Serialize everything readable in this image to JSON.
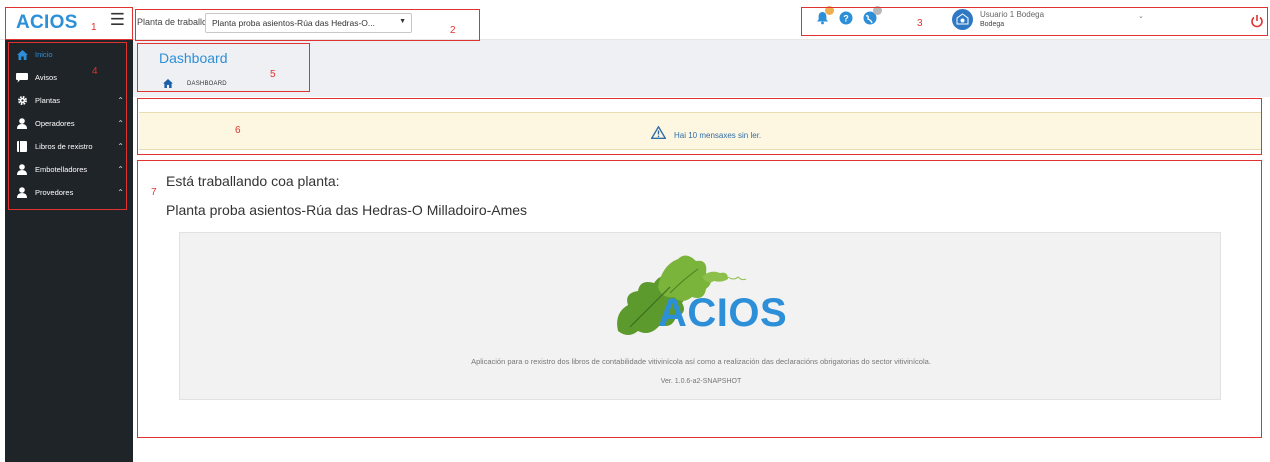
{
  "brand": {
    "logo_text": "ACIOS",
    "menu_icon": "hamburger-icon"
  },
  "plant_selector": {
    "label": "Planta de traballo",
    "selected": "Planta proba asientos-Rúa das Hedras-O..."
  },
  "top_icons": {
    "notifications_icon": "bell-icon",
    "notifications_badge": "",
    "help_icon": "question-circle-icon",
    "globe_icon": "globe-icon",
    "globe_badge": ""
  },
  "user": {
    "name": "Usuario 1 Bodega",
    "role": "Bodega",
    "avatar_icon": "seal-icon"
  },
  "power_icon": "power-icon",
  "sidebar": {
    "items": [
      {
        "label": "Inicio",
        "icon": "home-icon",
        "active": true,
        "expandable": false
      },
      {
        "label": "Avisos",
        "icon": "comment-icon",
        "active": false,
        "expandable": false
      },
      {
        "label": "Plantas",
        "icon": "gear-icon",
        "active": false,
        "expandable": true
      },
      {
        "label": "Operadores",
        "icon": "user-icon",
        "active": false,
        "expandable": true
      },
      {
        "label": "Libros de rexistro",
        "icon": "book-icon",
        "active": false,
        "expandable": true
      },
      {
        "label": "Embotelladores",
        "icon": "user-icon",
        "active": false,
        "expandable": true
      },
      {
        "label": "Provedores",
        "icon": "user-icon",
        "active": false,
        "expandable": true
      }
    ]
  },
  "header": {
    "title": "Dashboard",
    "breadcrumb": "DASHBOARD",
    "breadcrumb_icon": "home-icon"
  },
  "alert": {
    "icon": "warning-icon",
    "text": "Hai 10 mensaxes sin ler."
  },
  "work": {
    "line1": "Está traballando coa planta:",
    "line2": "Planta proba asientos-Rúa das Hedras-O Milladoiro-Ames"
  },
  "info": {
    "logo_text": "ACIOS",
    "logo_icon": "grape-leaves-icon",
    "description": "Aplicación para o rexistro dos libros de contabilidade vitivinícola así como a realización das declaracións obrigatorias do sector vitivinícola.",
    "version": "Ver. 1.0.6-a2-SNAPSHOT"
  },
  "annotations": [
    "1",
    "2",
    "3",
    "4",
    "5",
    "6",
    "7"
  ],
  "colors": {
    "accent": "#2d8fd8",
    "sidebar_bg": "#1f2429",
    "annotation": "#e0332f",
    "alert_bg": "#fdf6e1"
  }
}
